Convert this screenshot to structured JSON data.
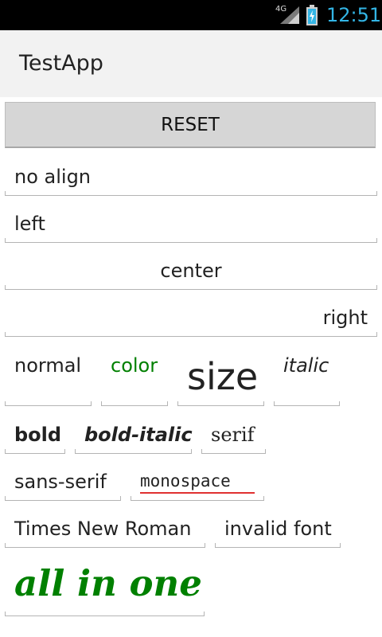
{
  "status_bar": {
    "network": "4G",
    "time": "12:51",
    "time_color": "#33b5e5",
    "signal_icon": "signal-icon",
    "battery_icon": "battery-charging-icon"
  },
  "app": {
    "title": "TestApp"
  },
  "reset_button": {
    "label": "RESET"
  },
  "fields": {
    "no_align": "no align",
    "left": "left",
    "center": "center",
    "right": "right",
    "normal": "normal",
    "color": "color",
    "size": "size",
    "italic": "italic",
    "bold": "bold",
    "bold_italic": "bold-italic",
    "serif": "serif",
    "sans_serif": "sans-serif",
    "monospace": "monospace",
    "times_new_roman": "Times New Roman",
    "invalid_font": "invalid font",
    "all_in_one": "all in one"
  },
  "colors": {
    "green_text": "#008000",
    "spellcheck_underline": "#e03030"
  }
}
